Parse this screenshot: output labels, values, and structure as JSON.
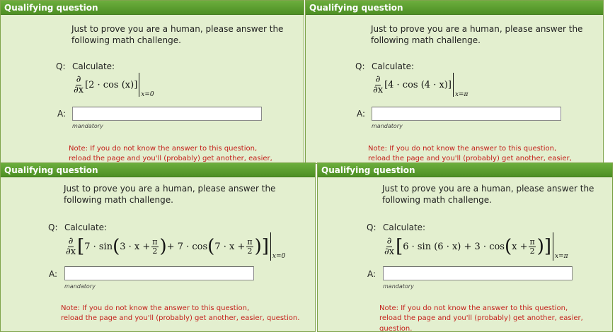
{
  "panels": [
    {
      "header": "Qualifying question",
      "intro": "Just to prove you are a human, please answer the following math challenge.",
      "question_label": "Q:",
      "calculate_label": "Calculate:",
      "math_bracket": "[2 · cos (x)]",
      "math_sub": "x=0",
      "answer_label": "A:",
      "answer_value": "",
      "mandatory": "mandatory",
      "note_line1": "Note: If you do not know the answer to this question,",
      "note_line2": "reload the page and you'll (probably) get another, easier, question."
    },
    {
      "header": "Qualifying question",
      "intro": "Just to prove you are a human, please answer the following math challenge.",
      "question_label": "Q:",
      "calculate_label": "Calculate:",
      "math_bracket": "[4 · cos (4 · x)]",
      "math_sub": "x=π",
      "answer_label": "A:",
      "answer_value": "",
      "mandatory": "mandatory",
      "note_line1": "Note: If you do not know the answer to this question,",
      "note_line2": "reload the page and you'll (probably) get another, easier, question."
    },
    {
      "header": "Qualifying question",
      "intro": "Just to prove you are a human, please answer the following math challenge.",
      "question_label": "Q:",
      "calculate_label": "Calculate:",
      "math_a": "7 · sin",
      "math_b": "3 · x +",
      "math_c": "+ 7 · cos",
      "math_d": "7 · x +",
      "math_sub": "x=0",
      "answer_label": "A:",
      "answer_value": "",
      "mandatory": "mandatory",
      "note_line1": "Note: If you do not know the answer to this question,",
      "note_line2": "reload the page and you'll (probably) get another, easier, question."
    },
    {
      "header": "Qualifying question",
      "intro": "Just to prove you are a human, please answer the following math challenge.",
      "question_label": "Q:",
      "calculate_label": "Calculate:",
      "math_a": "6 · sin (6 · x) + 3 · cos",
      "math_b": "x +",
      "math_sub": "x=π",
      "answer_label": "A:",
      "answer_value": "",
      "mandatory": "mandatory",
      "note_line1": "Note: If you do not know the answer to this question,",
      "note_line2": "reload the page and you'll (probably) get another, easier, question."
    }
  ],
  "symbols": {
    "partial": "∂",
    "partial_x": "∂x",
    "pi": "π",
    "two": "2"
  }
}
